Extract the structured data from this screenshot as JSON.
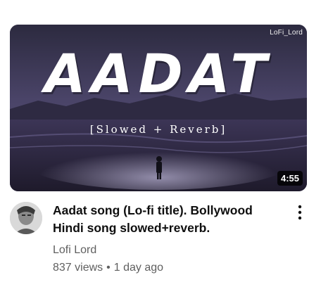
{
  "thumbnail": {
    "watermark": "LoFi_Lord",
    "title_text": "AADAT",
    "subtitle_text": "[Slowed + Reverb]",
    "duration": "4:55"
  },
  "video": {
    "title": "Aadat song (Lo-fi title). Bollywood Hindi song slowed+reverb.",
    "channel": "Lofi Lord",
    "views": "837 views",
    "separator": "•",
    "age": "1 day ago"
  },
  "icons": {
    "menu": "more-vert-icon"
  },
  "colors": {
    "title_text": "#0f0f0f",
    "secondary_text": "#606060",
    "thumbnail_tint": "#3b3650"
  }
}
